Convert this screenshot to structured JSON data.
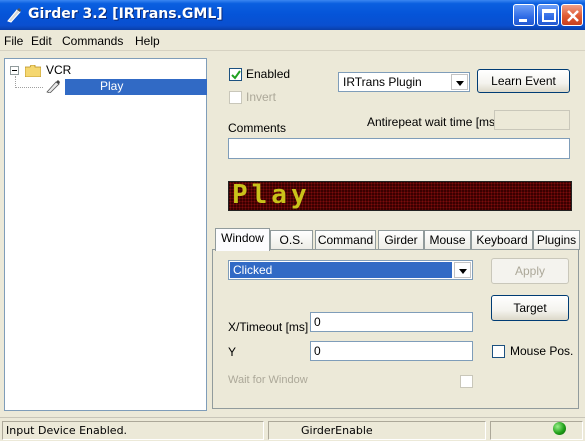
{
  "window": {
    "title": "Girder 3.2 [IRTrans.GML]"
  },
  "menu": [
    "File",
    "Edit",
    "Commands",
    "Help"
  ],
  "tree": {
    "root_label": "VCR",
    "child_label": "Play"
  },
  "event": {
    "enabled_label": "Enabled",
    "enabled_checked": true,
    "invert_label": "Invert",
    "plugin_select": "IRTrans Plugin",
    "learn_button": "Learn Event",
    "antirepeat_label": "Antirepeat wait time [ms]",
    "antirepeat_value": "",
    "comments_label": "Comments",
    "comments_value": "",
    "display_text": "Play"
  },
  "tabs": [
    "Window",
    "O.S.",
    "Command",
    "Girder",
    "Mouse",
    "Keyboard",
    "Plugins"
  ],
  "active_tab": "Window",
  "window_tab": {
    "action_select": "Clicked",
    "apply_button": "Apply",
    "target_button": "Target",
    "xtimeout_label": "X/Timeout [ms]",
    "xtimeout_value": "0",
    "y_label": "Y",
    "y_value": "0",
    "mouse_pos_label": "Mouse Pos.",
    "wait_for_window_label": "Wait for Window"
  },
  "status": {
    "left": "Input Device Enabled.",
    "middle": "GirderEnable"
  },
  "colors": {
    "titlebar": "#0554d8",
    "selection": "#316ac5",
    "led_text": "#c9c21a",
    "led_bg": "#3a0000",
    "status_led": "#20a01a"
  }
}
